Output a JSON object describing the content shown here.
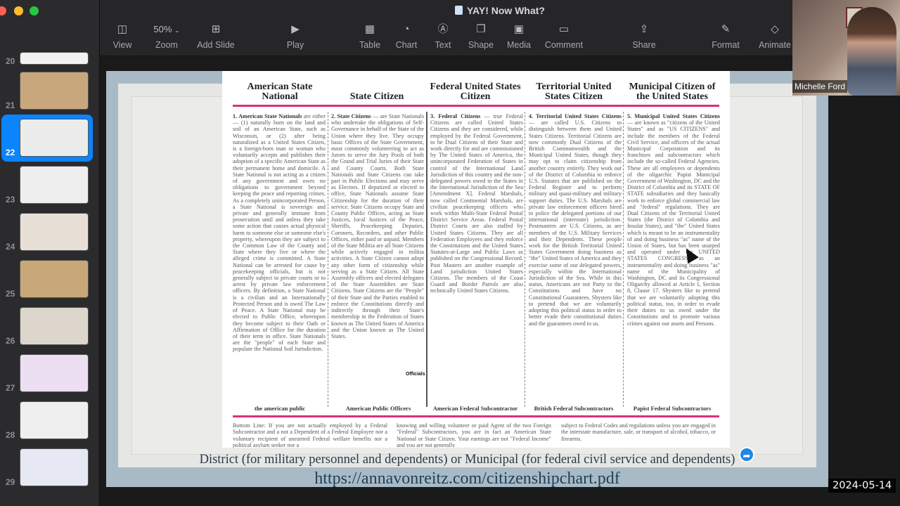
{
  "window": {
    "title": "YAY! Now What?",
    "traffic_lights": {
      "close": "#ff5f57",
      "minimize": "#febc2e",
      "zoom": "#28c840"
    }
  },
  "toolbar": {
    "items": [
      {
        "id": "view",
        "label": "View",
        "icon": "sidebar-icon"
      },
      {
        "id": "zoom",
        "label": "Zoom",
        "value": "50%",
        "icon": "chevron-down-icon"
      },
      {
        "id": "add-slide",
        "label": "Add Slide",
        "icon": "add-slide-icon"
      },
      {
        "id": "play",
        "label": "Play",
        "icon": "play-icon"
      },
      {
        "id": "table",
        "label": "Table",
        "icon": "table-icon"
      },
      {
        "id": "chart",
        "label": "Chart",
        "icon": "chart-icon"
      },
      {
        "id": "text",
        "label": "Text",
        "icon": "text-icon"
      },
      {
        "id": "shape",
        "label": "Shape",
        "icon": "shape-icon"
      },
      {
        "id": "media",
        "label": "Media",
        "icon": "media-icon"
      },
      {
        "id": "comment",
        "label": "Comment",
        "icon": "comment-icon"
      },
      {
        "id": "share",
        "label": "Share",
        "icon": "share-icon"
      },
      {
        "id": "format",
        "label": "Format",
        "icon": "format-brush-icon"
      },
      {
        "id": "animate",
        "label": "Animate",
        "icon": "animate-icon"
      }
    ]
  },
  "sidebar": {
    "selected": "22",
    "slides": [
      {
        "number": "20"
      },
      {
        "number": "21"
      },
      {
        "number": "22"
      },
      {
        "number": "23"
      },
      {
        "number": "24"
      },
      {
        "number": "25"
      },
      {
        "number": "26"
      },
      {
        "number": "27"
      },
      {
        "number": "28"
      },
      {
        "number": "29"
      }
    ]
  },
  "slide": {
    "columns": [
      {
        "heading": "American State National",
        "body_title": "1. American State Nationals",
        "body": "are either — (1) naturally born on the land and soil of an American State, such as Wisconsin, or (2) after being naturalized as a United States Citizen, is a foreign-born man or woman who voluntarily accepts and publishes their adoption of a specific American State as their permanent home and domicile. A State National is not acting as a citizen of any government and owes no obligations to government beyond keeping the peace and reporting crimes. As a completely unincorporated Person, a State National is sovereign and private and generally immune from prosecution until and unless they take some action that causes actual physical harm to someone else or someone else's property, whereupon they are subject to the Common Law of the County and State where they live or where the alleged crime is committed. A State National can be arrested for cause by peacekeeping officials, but is not generally subject to private courts or to arrest by private law enforcement officers. By definition, a State National is a civilian and an Internationally Protected Person and is owed The Law of Peace. A State National may be elected to Public Office, whereupon they become subject to their Oath or Affirmation of Office for the duration of their term in office. State Nationals are the \"people\" of each State and populate the National Soil Jurisdiction.",
        "footer": "the american public"
      },
      {
        "heading": "State Citizen",
        "body_title": "2. State Citizens",
        "body": "— are State Nationals who undertake the obligations of Self-Governance in behalf of the State of the Union where they live. They occupy basic Offices of the State Government, most commonly volunteering to act as Jurors to serve the Jury Pools of both the Grand and Trial Juries of their State and County Courts. Both State Nationals and State Citizens can take part in Public Elections and may serve as Electors. If deputized or elected to office, State Nationals assume State Citizenship for the duration of their service. State Citizens occupy State and County Public Offices, acting as State Justices, local Justices of the Peace, Sheriffs, Peacekeeping Deputies, Coroners, Recorders, and other Public Offices, either paid or unpaid. Members of the State Militia are all State Citizens while actively engaged in militia activities. A State Citizen cannot adopt any other form of citizenship while serving as a State Citizen. All State Assembly officers and elected delegates of the State Assemblies are State Citizens. State Citizens are the \"People\" of their State and the Parties enabled to enforce the Constitutions directly and indirectly through their State's membership in the Federation of States known as The United States of America and the Union known as The United States.",
        "annotation": "Officials",
        "footer": "American Public Officers"
      },
      {
        "heading": "Federal United States Citizen",
        "body_title": "3. Federal Citizens",
        "body": "— true Federal Citizens are called United States Citizens and they are considered, while employed by the Federal Government, to be Dual Citizens of their State and work directly for and are commissioned by The United States of America, the unincorporated Federation of States in control of the International Land Jurisdiction of this country and the non-delegated powers owed to the States in the International Jurisdiction of the Sea [Amendment X]. Federal Marshals, now called Continental Marshals, are civilian peacekeeping officers who work within Multi-State Federal Postal District Service Areas. Federal Postal District Courts are also staffed by United States Citizens. They are all Federation Employees and they enforce the Constitutions and the United States Statutes-at-Large and Public Laws as published on the Congressional Record. Post Masters are another example of Land jurisdiction United States Citizens. The members of the Coast Guard and Border Patrols are also technically United States Citizens.",
        "footer": "American Federal Subcontractor"
      },
      {
        "heading": "Territorial United States Citizen",
        "body_title": "4. Territorial United States Citizens",
        "body": "— are called U.S. Citizens to distinguish between them and United States Citizens. Territorial Citizens are now commonly Dual Citizens of the British Commonwealth and the Municipal United States, though they may opt to claim citizenship from another country entirely. They work out of the District of Columbia to enforce U.S. Statutes that are published on the Federal Register and to perform military and quasi-military and military support duties. The U.S. Marshals are private law enforcement officers hired to police the delegated portions of our international (interstate) jurisdiction. Postmasters are U.S. Citizens, as are members of the U.S. Military Services and their Dependents. These people work for the British Territorial United States Government doing business as \"the\" United States of America and they exercise some of our delegated powers, especially within the International Jurisdiction of the Sea. While in this status, Americans are not Party to the Constitutions and have no Constitutional Guarantees. Shysters like to pretend that we are voluntarily adopting this political status in order to better evade their constitutional duties and the guarantees owed to us.",
        "footer": "British Federal Subcontractors"
      },
      {
        "heading": "Municipal Citizen of the United States",
        "body_title": "5. Municipal United States Citizens",
        "body": "— are known as \"citizens of the United States\" and as \"US CITIZENS\" and include the members of the Federal Civil Service, and officers of the actual Municipal Corporation and its franchises and subcontractors which include the so-called Federal Agencies. These are all employees or dependents of the oligarchic Papist Municipal Government of Washington, DC and the District of Columbia and its STATE OF STATE subsidiaries and they basically work to enforce global commercial law and \"federal\" regulations. They are Dual Citizens of the Territorial United States (the District of Columbia and Insular States), and \"the\" United States which is meant to be an instrumentality of and doing business \"as\" name of the Union of States, but has been usurped and operated under the UNITED STATES CONGRESS as an instrumentality and doing business \"as\" name of the Municipality of Washington, DC and its Congressional Oligarchy allowed at Article I, Section 8, Clause 17. Shysters like to pretend that we are voluntarily adopting this political status, too, in order to evade their duties to us owed under the Constitutions and to promote various crimes against our assets and Persons.",
        "footer": "Papist Federal Subcontractors"
      }
    ],
    "bottom_line": [
      "Bottom Line: If you are not actually employed by a Federal Subcontractor and a not a Dependent of a Federal Employee nor a voluntary recipient of unearned Federal welfare benefits nor a political asylum seeker nor a",
      "knowing and willing volunteer or paid Agent of the two Foreign \"Federal\" Subcontractors, you are in fact an American State National or State Citizen. Your earnings are not \"Federal Income\" and you are not generally",
      "subject to Federal Codes and regulations unless you are engaged in the interstate manufacture, sale, or transport of alcohol, tobacco, or firearms."
    ],
    "caption": "District (for military personnel and dependents) or Municipal (for federal civil service and dependents)",
    "url": "https://annavonreitz.com/citizenshipchart.pdf"
  },
  "video_overlay": {
    "participant_name": "Michelle Ford"
  },
  "datestamp": "2024-05-14"
}
